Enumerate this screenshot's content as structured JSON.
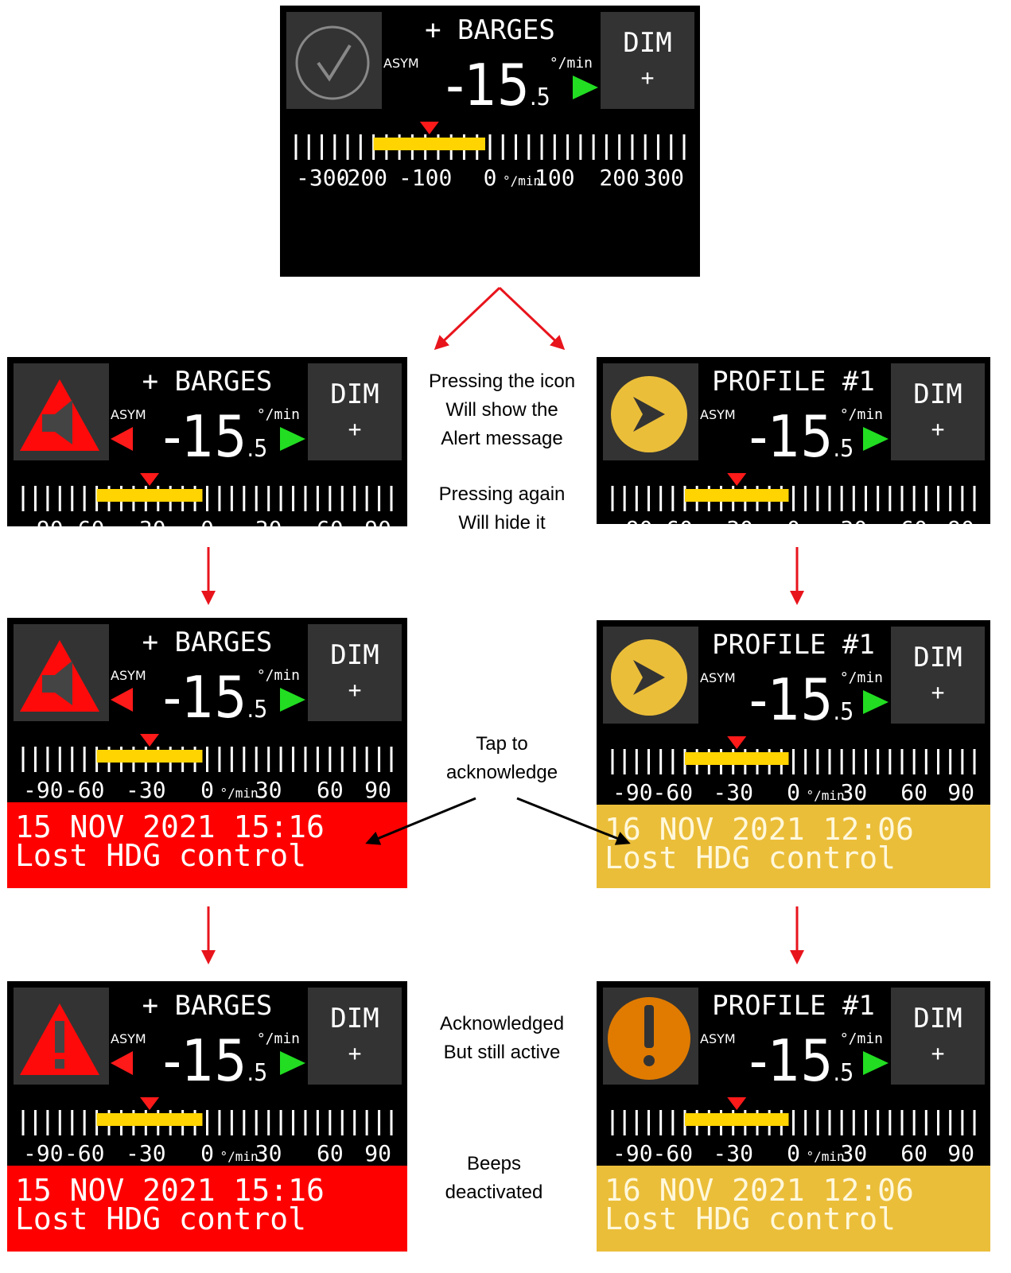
{
  "panels": [
    {
      "id": "top",
      "title": "+ BARGES",
      "icon": "check-circle-icon",
      "left_arrow": false,
      "range": "300",
      "alert": null
    },
    {
      "id": "a1",
      "title": "+ BARGES",
      "icon": "red-speaker-triangle-icon",
      "left_arrow": true,
      "range": "90",
      "alert": null
    },
    {
      "id": "a2",
      "title": "+ BARGES",
      "icon": "red-speaker-triangle-icon",
      "left_arrow": true,
      "range": "90",
      "alert": {
        "date": "15 NOV 2021 15:16",
        "message": "Lost HDG control",
        "color": "#ff0000"
      }
    },
    {
      "id": "a3",
      "title": "+ BARGES",
      "icon": "red-exclamation-triangle-icon",
      "left_arrow": true,
      "range": "90",
      "alert": {
        "date": "15 NOV 2021 15:16",
        "message": "Lost HDG control",
        "color": "#ff0000"
      }
    },
    {
      "id": "b1",
      "title": "PROFILE #1",
      "icon": "yellow-speaker-circle-icon",
      "left_arrow": false,
      "range": "90",
      "alert": null
    },
    {
      "id": "b2",
      "title": "PROFILE #1",
      "icon": "yellow-speaker-circle-icon",
      "left_arrow": false,
      "range": "90",
      "alert": {
        "date": "16 NOV 2021 12:06",
        "message": "Lost HDG control",
        "color": "#ebbe3a"
      }
    },
    {
      "id": "b3",
      "title": "PROFILE #1",
      "icon": "orange-exclamation-circle-icon",
      "left_arrow": false,
      "range": "90",
      "alert": {
        "date": "16 NOV 2021 12:06",
        "message": "Lost HDG control",
        "color": "#ebbe3a"
      }
    }
  ],
  "display": {
    "value_int": "-15",
    "value_dec": ".5",
    "asym_label": "ASYM",
    "unit": "°/min",
    "dim_label": "DIM",
    "plus_label": "+",
    "scale_unit": "°/min",
    "ticks_300": [
      "-300",
      "-200",
      "-100",
      "0",
      "100",
      "200",
      "300"
    ],
    "ticks_90": [
      "-90",
      "-60",
      "-30",
      "0",
      "30",
      "60",
      "90"
    ]
  },
  "annotations": {
    "press_icon": [
      "Pressing the icon",
      "Will show the",
      "Alert message"
    ],
    "press_again": [
      "Pressing again",
      "Will hide it"
    ],
    "tap_ack": [
      "Tap to",
      "acknowledge"
    ],
    "acknowledged": [
      "Acknowledged",
      "But still active"
    ],
    "beeps": [
      "Beeps",
      "deactivated"
    ]
  },
  "colors": {
    "gauge_bar": "#ffd400",
    "green_arrow": "#22dd22",
    "red_arrow": "#ff1a1a",
    "alert_red": "#ff0000",
    "alert_yellow": "#ebbe3a",
    "button_gray": "#333333",
    "flow_arrow_red": "#e8141c",
    "flow_arrow_black": "#000000"
  }
}
